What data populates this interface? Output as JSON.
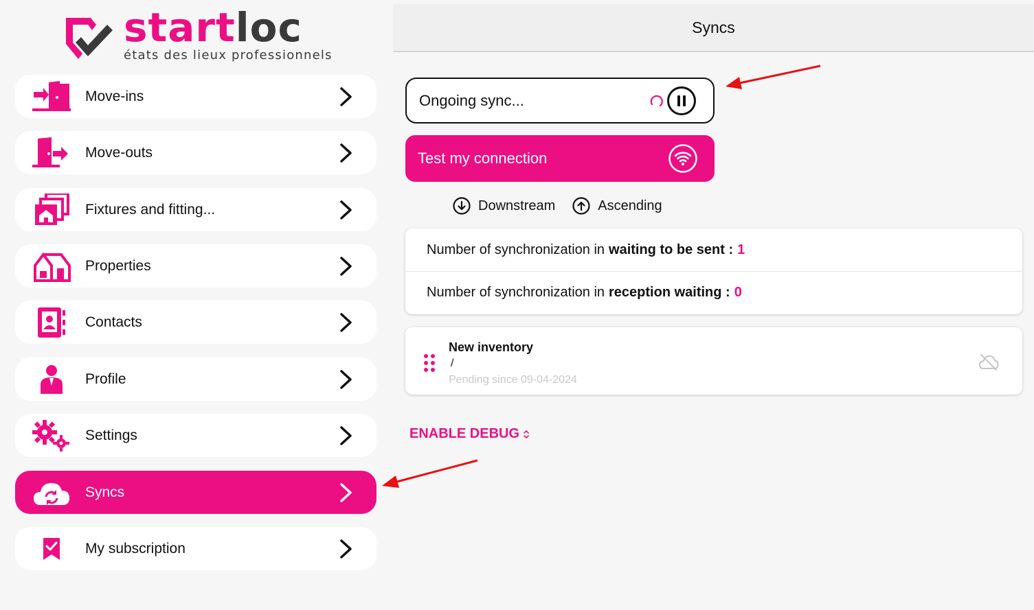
{
  "brand": {
    "name_part1": "start",
    "name_part2": "loc",
    "tagline": "états des lieux professionnels"
  },
  "colors": {
    "accent": "#ec0f84",
    "annotation_arrow": "#e81010"
  },
  "sidebar": {
    "items": [
      {
        "label": "Move-ins",
        "icon": "move-in-door-icon",
        "active": false
      },
      {
        "label": "Move-outs",
        "icon": "move-out-door-icon",
        "active": false
      },
      {
        "label": "Fixtures and fitting...",
        "icon": "fixtures-stack-icon",
        "active": false
      },
      {
        "label": "Properties",
        "icon": "house-icon",
        "active": false
      },
      {
        "label": "Contacts",
        "icon": "contact-book-icon",
        "active": false
      },
      {
        "label": "Profile",
        "icon": "person-icon",
        "active": false
      },
      {
        "label": "Settings",
        "icon": "gears-icon",
        "active": false
      },
      {
        "label": "Syncs",
        "icon": "cloud-sync-icon",
        "active": true
      },
      {
        "label": "My subscription",
        "icon": "bookmark-check-icon",
        "active": false
      }
    ]
  },
  "header": {
    "title": "Syncs"
  },
  "sync_status": {
    "label": "Ongoing sync...",
    "control": "pause-icon"
  },
  "test_connection": {
    "label": "Test my connection",
    "icon": "wifi-icon"
  },
  "legend": {
    "downstream": "Downstream",
    "ascending": "Ascending"
  },
  "stats": {
    "row1_prefix": "Number of synchronization in",
    "row1_bold": "waiting to be sent :",
    "row1_value": "1",
    "row2_prefix": "Number of synchronization in",
    "row2_bold": "reception waiting :",
    "row2_value": "0"
  },
  "pending_item": {
    "title": "New inventory",
    "subtitle": "/",
    "date_text": "Pending since 09-04-2024",
    "status_icon": "cloud-off-icon"
  },
  "debug": {
    "label": "ENABLE DEBUG"
  }
}
